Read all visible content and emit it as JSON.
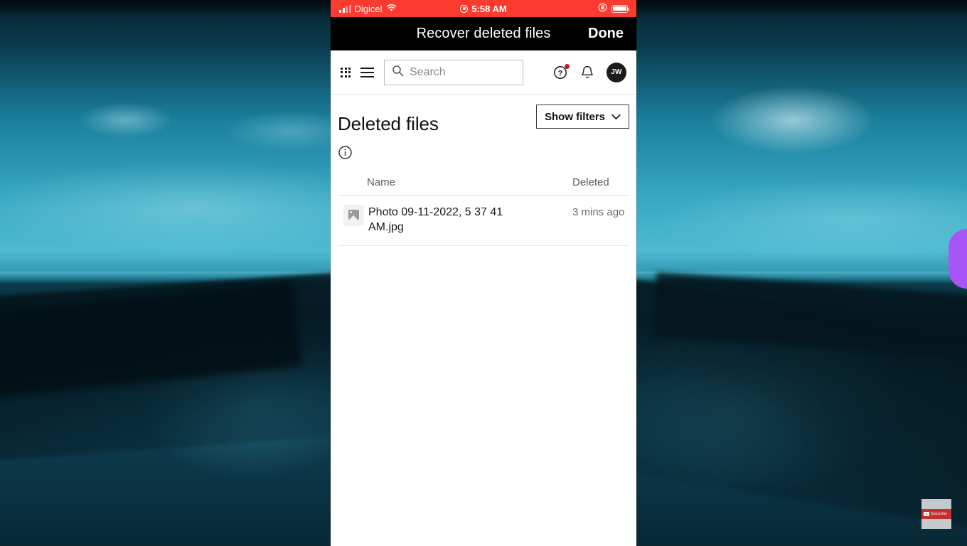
{
  "status_bar": {
    "carrier": "Digicel",
    "signal_icon": "signal-bars-icon",
    "wifi_icon": "wifi-icon",
    "recording_icon": "screen-recording-icon",
    "time": "5:58 AM",
    "rotation_lock_icon": "rotation-lock-icon",
    "battery_icon": "battery-full-icon",
    "bar_color": "#fb3b2f"
  },
  "modal_bar": {
    "title": "Recover deleted files",
    "done_label": "Done",
    "bar_color": "#000000"
  },
  "appbar": {
    "grid_icon": "app-launcher-grid-icon",
    "menu_icon": "hamburger-menu-icon",
    "search": {
      "icon": "search-icon",
      "placeholder": "Search",
      "value": ""
    },
    "help_icon": "help-question-circle-icon",
    "help_badge_color": "#c8102e",
    "notifications_icon": "bell-icon",
    "avatar_initials": "JW",
    "avatar_color": "#1b1b1b"
  },
  "page": {
    "title": "Deleted files",
    "show_filters_label": "Show filters",
    "show_filters_chevron": "chevron-down-icon",
    "info_icon": "info-circle-icon"
  },
  "table": {
    "columns": [
      "Name",
      "Deleted"
    ],
    "rows": [
      {
        "icon": "image-file-icon",
        "name": "Photo 09-11-2022, 5 37 41 AM.jpg",
        "deleted": "3 mins ago"
      }
    ]
  },
  "overlay": {
    "subscribe_label": "Subscribe",
    "subscribe_play_icon": "youtube-play-icon",
    "subscribe_color": "#c4302b",
    "accent_pill_color": "#a855f7"
  }
}
